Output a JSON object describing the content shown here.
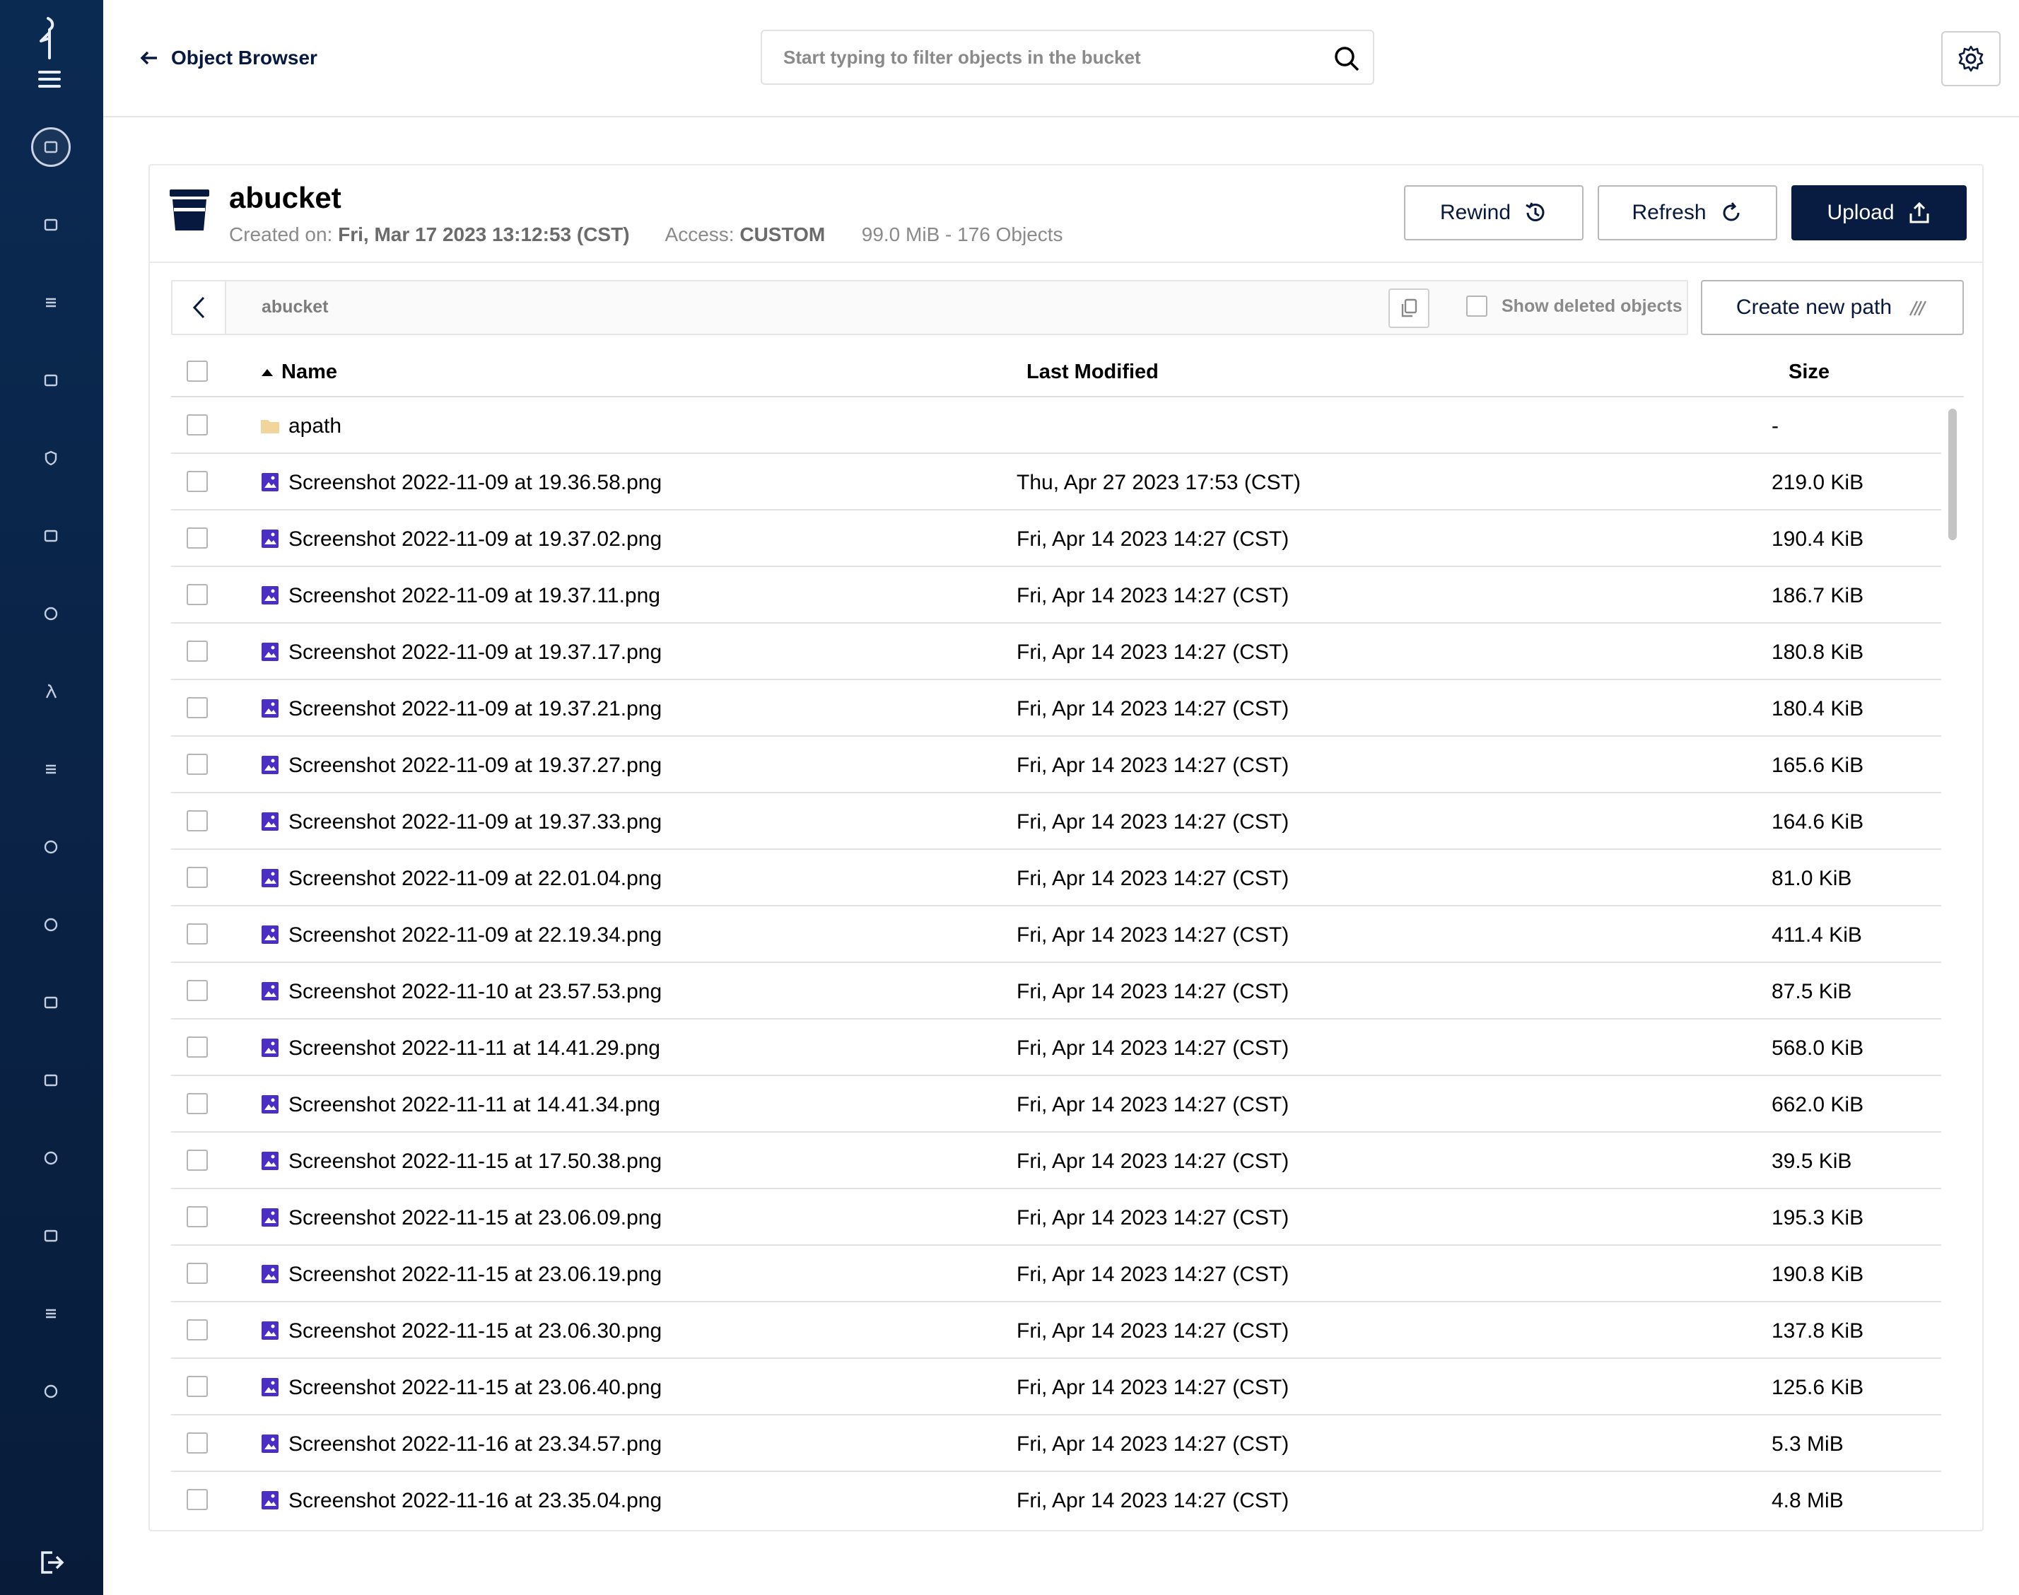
{
  "header": {
    "back_label": "Object Browser",
    "search_placeholder": "Start typing to filter objects in the bucket"
  },
  "sidebar": {
    "items": [
      {
        "icon": "object-browser-icon",
        "active": true
      },
      {
        "icon": "access-keys-icon"
      },
      {
        "icon": "documentation-icon"
      },
      {
        "icon": "buckets-icon"
      },
      {
        "icon": "policies-icon"
      },
      {
        "icon": "identity-icon"
      },
      {
        "icon": "monitoring-icon"
      },
      {
        "icon": "events-lambda-icon"
      },
      {
        "icon": "tiering-icon"
      },
      {
        "icon": "site-replication-icon"
      },
      {
        "icon": "settings-icon"
      },
      {
        "icon": "license-icon"
      },
      {
        "icon": "inspect-icon"
      },
      {
        "icon": "support-icon"
      },
      {
        "icon": "storage-icon"
      },
      {
        "icon": "tenants-icon"
      },
      {
        "icon": "call-home-icon"
      }
    ]
  },
  "bucket": {
    "name": "abucket",
    "created_label": "Created on:",
    "created_value": "Fri, Mar 17 2023 13:12:53 (CST)",
    "access_label": "Access:",
    "access_value": "CUSTOM",
    "usage": "99.0 MiB - 176 Objects"
  },
  "actions": {
    "rewind": "Rewind",
    "refresh": "Refresh",
    "upload": "Upload",
    "create_path": "Create new path",
    "show_deleted": "Show deleted objects"
  },
  "path": {
    "current": "abucket"
  },
  "table": {
    "columns": {
      "name": "Name",
      "modified": "Last Modified",
      "size": "Size"
    },
    "rows": [
      {
        "type": "folder",
        "name": "apath",
        "modified": "",
        "size": "-"
      },
      {
        "type": "image",
        "name": "Screenshot 2022-11-09 at 19.36.58.png",
        "modified": "Thu, Apr 27 2023 17:53 (CST)",
        "size": "219.0 KiB"
      },
      {
        "type": "image",
        "name": "Screenshot 2022-11-09 at 19.37.02.png",
        "modified": "Fri, Apr 14 2023 14:27 (CST)",
        "size": "190.4 KiB"
      },
      {
        "type": "image",
        "name": "Screenshot 2022-11-09 at 19.37.11.png",
        "modified": "Fri, Apr 14 2023 14:27 (CST)",
        "size": "186.7 KiB"
      },
      {
        "type": "image",
        "name": "Screenshot 2022-11-09 at 19.37.17.png",
        "modified": "Fri, Apr 14 2023 14:27 (CST)",
        "size": "180.8 KiB"
      },
      {
        "type": "image",
        "name": "Screenshot 2022-11-09 at 19.37.21.png",
        "modified": "Fri, Apr 14 2023 14:27 (CST)",
        "size": "180.4 KiB"
      },
      {
        "type": "image",
        "name": "Screenshot 2022-11-09 at 19.37.27.png",
        "modified": "Fri, Apr 14 2023 14:27 (CST)",
        "size": "165.6 KiB"
      },
      {
        "type": "image",
        "name": "Screenshot 2022-11-09 at 19.37.33.png",
        "modified": "Fri, Apr 14 2023 14:27 (CST)",
        "size": "164.6 KiB"
      },
      {
        "type": "image",
        "name": "Screenshot 2022-11-09 at 22.01.04.png",
        "modified": "Fri, Apr 14 2023 14:27 (CST)",
        "size": "81.0 KiB"
      },
      {
        "type": "image",
        "name": "Screenshot 2022-11-09 at 22.19.34.png",
        "modified": "Fri, Apr 14 2023 14:27 (CST)",
        "size": "411.4 KiB"
      },
      {
        "type": "image",
        "name": "Screenshot 2022-11-10 at 23.57.53.png",
        "modified": "Fri, Apr 14 2023 14:27 (CST)",
        "size": "87.5 KiB"
      },
      {
        "type": "image",
        "name": "Screenshot 2022-11-11 at 14.41.29.png",
        "modified": "Fri, Apr 14 2023 14:27 (CST)",
        "size": "568.0 KiB"
      },
      {
        "type": "image",
        "name": "Screenshot 2022-11-11 at 14.41.34.png",
        "modified": "Fri, Apr 14 2023 14:27 (CST)",
        "size": "662.0 KiB"
      },
      {
        "type": "image",
        "name": "Screenshot 2022-11-15 at 17.50.38.png",
        "modified": "Fri, Apr 14 2023 14:27 (CST)",
        "size": "39.5 KiB"
      },
      {
        "type": "image",
        "name": "Screenshot 2022-11-15 at 23.06.09.png",
        "modified": "Fri, Apr 14 2023 14:27 (CST)",
        "size": "195.3 KiB"
      },
      {
        "type": "image",
        "name": "Screenshot 2022-11-15 at 23.06.19.png",
        "modified": "Fri, Apr 14 2023 14:27 (CST)",
        "size": "190.8 KiB"
      },
      {
        "type": "image",
        "name": "Screenshot 2022-11-15 at 23.06.30.png",
        "modified": "Fri, Apr 14 2023 14:27 (CST)",
        "size": "137.8 KiB"
      },
      {
        "type": "image",
        "name": "Screenshot 2022-11-15 at 23.06.40.png",
        "modified": "Fri, Apr 14 2023 14:27 (CST)",
        "size": "125.6 KiB"
      },
      {
        "type": "image",
        "name": "Screenshot 2022-11-16 at 23.34.57.png",
        "modified": "Fri, Apr 14 2023 14:27 (CST)",
        "size": "5.3 MiB"
      },
      {
        "type": "image",
        "name": "Screenshot 2022-11-16 at 23.35.04.png",
        "modified": "Fri, Apr 14 2023 14:27 (CST)",
        "size": "4.8 MiB"
      }
    ]
  },
  "colors": {
    "sidebar": "#0b2a52",
    "primary": "#081c42",
    "image_icon": "#4b2fc4",
    "folder_icon": "#f2d59a"
  }
}
